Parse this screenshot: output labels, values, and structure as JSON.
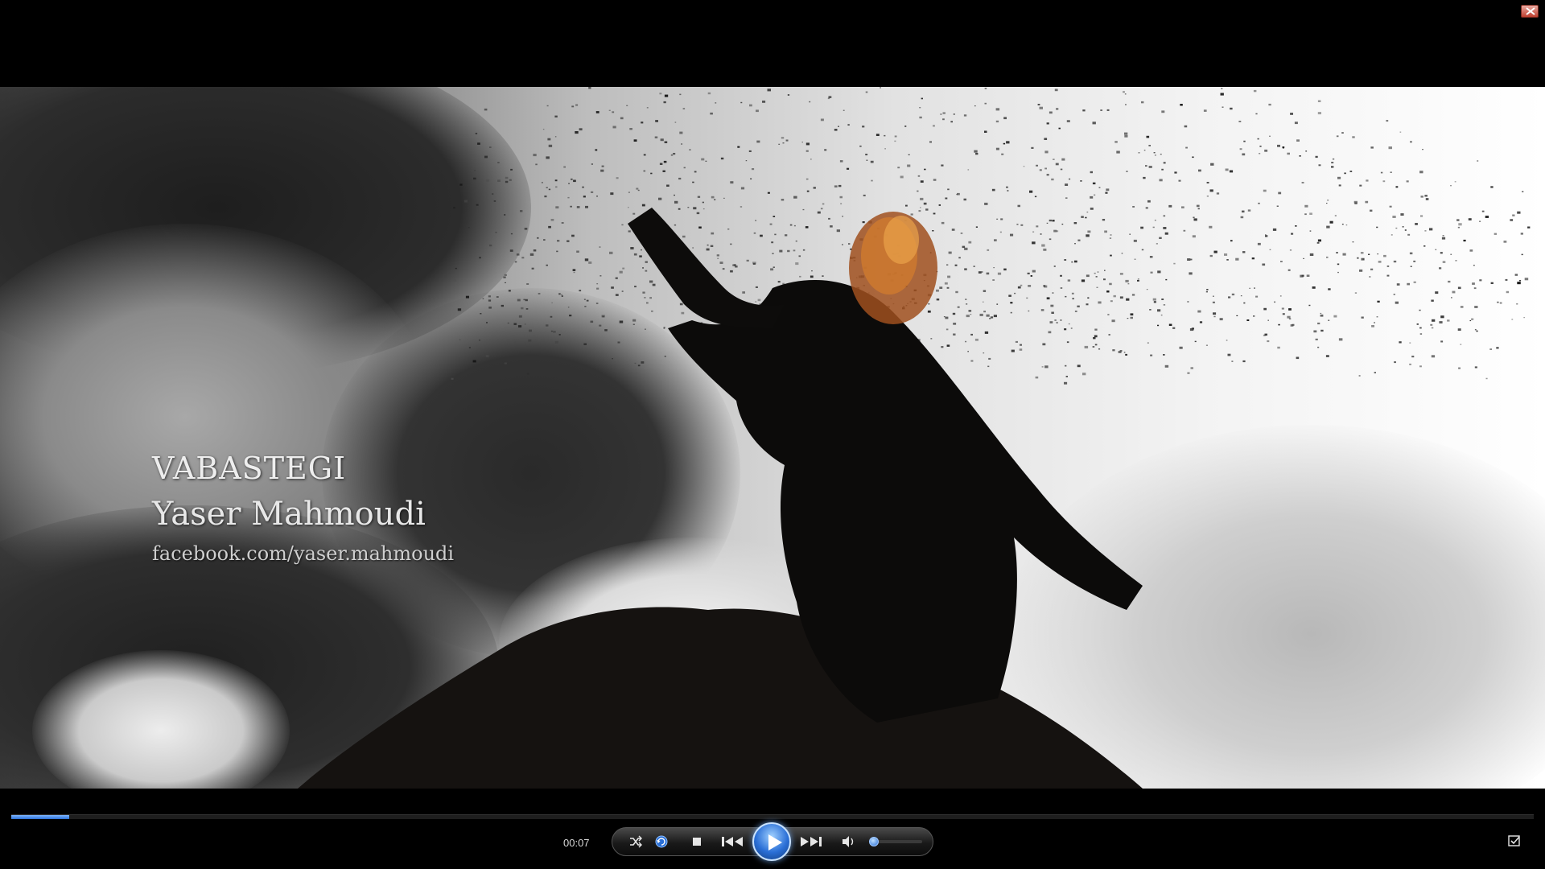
{
  "window": {
    "close_icon": "close-icon"
  },
  "video": {
    "overlay_title": "VABASTEGI",
    "overlay_artist": "Yaser Mahmoudi",
    "overlay_facebook": "facebook.com/yaser.mahmoudi"
  },
  "playback": {
    "time": "00:07",
    "progress_fraction": 0.038,
    "volume_fraction": 0.04
  },
  "controls": {
    "shuffle_icon": "shuffle-icon",
    "repeat_icon": "repeat-icon",
    "stop_icon": "stop-icon",
    "previous_icon": "previous-icon",
    "play_icon": "play-icon",
    "next_icon": "next-icon",
    "volume_icon": "speaker-icon",
    "switch_view_icon": "switch-to-library-icon"
  },
  "colors": {
    "accent": "#2a6fd6",
    "close": "#c04030"
  }
}
